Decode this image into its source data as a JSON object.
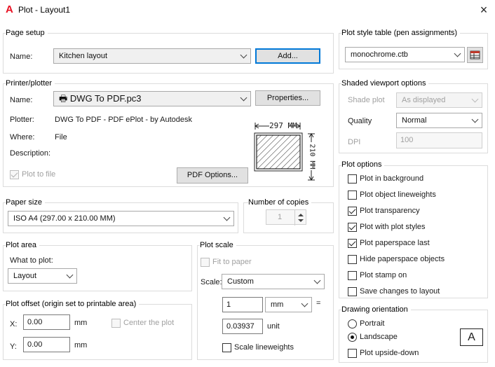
{
  "window": {
    "title": "Plot - Layout1",
    "close": "×",
    "app_icon": "A"
  },
  "page_setup": {
    "group": "Page setup",
    "name_label": "Name:",
    "name_value": "Kitchen layout",
    "add_button": "Add..."
  },
  "printer": {
    "group": "Printer/plotter",
    "name_label": "Name:",
    "name_value": "DWG To PDF.pc3",
    "properties_button": "Properties...",
    "plotter_label": "Plotter:",
    "plotter_value": "DWG To PDF - PDF ePlot - by Autodesk",
    "where_label": "Where:",
    "where_value": "File",
    "description_label": "Description:",
    "plot_to_file": "Plot to file",
    "pdf_options_button": "PDF Options...",
    "preview_width": "297 MM",
    "preview_height": "210 MM"
  },
  "paper_size": {
    "group": "Paper size",
    "value": "ISO A4 (297.00 x 210.00 MM)"
  },
  "copies": {
    "group": "Number of copies",
    "value": "1"
  },
  "plot_area": {
    "group": "Plot area",
    "what_label": "What to plot:",
    "value": "Layout"
  },
  "plot_offset": {
    "group": "Plot offset (origin set to printable area)",
    "x_label": "X:",
    "x_value": "0.00",
    "x_unit": "mm",
    "y_label": "Y:",
    "y_value": "0.00",
    "y_unit": "mm",
    "center": "Center the plot"
  },
  "plot_scale": {
    "group": "Plot scale",
    "fit": "Fit to paper",
    "scale_label": "Scale:",
    "scale_value": "Custom",
    "num_value": "1",
    "num_unit": "mm",
    "equals": "=",
    "den_value": "0.03937",
    "den_unit": "unit",
    "lineweights": "Scale lineweights"
  },
  "plot_style": {
    "group": "Plot style table (pen assignments)",
    "value": "monochrome.ctb"
  },
  "shaded": {
    "group": "Shaded viewport options",
    "shade_label": "Shade plot",
    "shade_value": "As displayed",
    "quality_label": "Quality",
    "quality_value": "Normal",
    "dpi_label": "DPI",
    "dpi_value": "100"
  },
  "plot_options": {
    "group": "Plot options",
    "items": [
      {
        "label": "Plot in background",
        "checked": false
      },
      {
        "label": "Plot object lineweights",
        "checked": false
      },
      {
        "label": "Plot transparency",
        "checked": true
      },
      {
        "label": "Plot with plot styles",
        "checked": true
      },
      {
        "label": "Plot paperspace last",
        "checked": true
      },
      {
        "label": "Hide paperspace objects",
        "checked": false
      },
      {
        "label": "Plot stamp on",
        "checked": false
      },
      {
        "label": "Save changes to layout",
        "checked": false
      }
    ]
  },
  "orientation": {
    "group": "Drawing orientation",
    "portrait": "Portrait",
    "landscape": "Landscape",
    "upside_down": "Plot upside-down",
    "icon_letter": "A"
  }
}
